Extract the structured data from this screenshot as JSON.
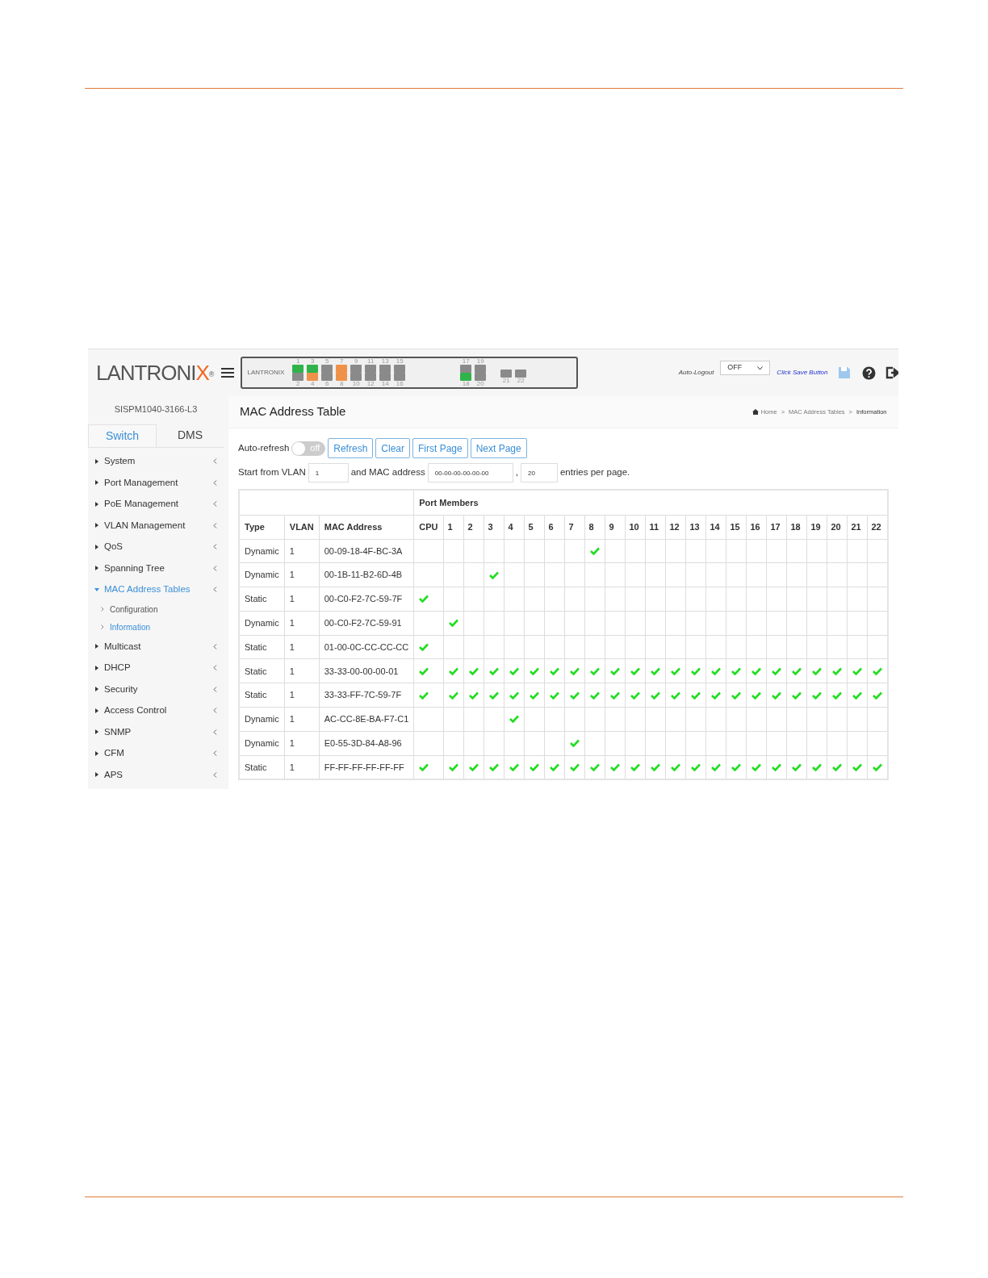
{
  "header": {
    "logo": {
      "text": "LANTRONI",
      "accent": "X",
      "mark": "®"
    },
    "device": {
      "brand": "LANTRONIX",
      "ports": [
        {
          "label": "1",
          "color": "#2fb34a"
        },
        {
          "label": "2",
          "color": "#8a8a8a"
        },
        {
          "label": "3",
          "color": "#2fb34a"
        },
        {
          "label": "4",
          "color": "#f0914a"
        },
        {
          "label": "5",
          "color": "#8a8a8a"
        },
        {
          "label": "6",
          "color": "#8a8a8a"
        },
        {
          "label": "7",
          "color": "#f0914a"
        },
        {
          "label": "8",
          "color": "#f0914a"
        },
        {
          "label": "9",
          "color": "#8a8a8a"
        },
        {
          "label": "10",
          "color": "#8a8a8a"
        },
        {
          "label": "11",
          "color": "#8a8a8a"
        },
        {
          "label": "12",
          "color": "#8a8a8a"
        },
        {
          "label": "13",
          "color": "#8a8a8a"
        },
        {
          "label": "14",
          "color": "#8a8a8a"
        },
        {
          "label": "15",
          "color": "#8a8a8a"
        },
        {
          "label": "16",
          "color": "#8a8a8a"
        }
      ],
      "sfp_ports": [
        {
          "label": "17",
          "color": "#8a8a8a"
        },
        {
          "label": "18",
          "color": "#2fb34a"
        },
        {
          "label": "19",
          "color": "#8a8a8a"
        },
        {
          "label": "20",
          "color": "#8a8a8a"
        }
      ],
      "extra_ports": [
        {
          "label": "21",
          "color": "#8a8a8a"
        },
        {
          "label": "22",
          "color": "#8a8a8a"
        }
      ]
    },
    "auto_logout": {
      "label": "Auto-Logout",
      "value": "OFF"
    },
    "save_hint": "Click Save Button"
  },
  "sidebar": {
    "model": "SISPM1040-3166-L3",
    "tabs": [
      {
        "label": "Switch",
        "selected": true
      },
      {
        "label": "DMS",
        "selected": false
      }
    ],
    "items": [
      {
        "label": "System",
        "expanded": false
      },
      {
        "label": "Port Management",
        "expanded": false
      },
      {
        "label": "PoE Management",
        "expanded": false
      },
      {
        "label": "VLAN Management",
        "expanded": false
      },
      {
        "label": "QoS",
        "expanded": false
      },
      {
        "label": "Spanning Tree",
        "expanded": false
      },
      {
        "label": "MAC Address Tables",
        "expanded": true,
        "children": [
          {
            "label": "Configuration",
            "selected": false
          },
          {
            "label": "Information",
            "selected": true
          }
        ]
      },
      {
        "label": "Multicast",
        "expanded": false
      },
      {
        "label": "DHCP",
        "expanded": false
      },
      {
        "label": "Security",
        "expanded": false
      },
      {
        "label": "Access Control",
        "expanded": false
      },
      {
        "label": "SNMP",
        "expanded": false
      },
      {
        "label": "CFM",
        "expanded": false
      },
      {
        "label": "APS",
        "expanded": false
      }
    ]
  },
  "page": {
    "title": "MAC Address Table",
    "breadcrumb": [
      {
        "label": "Home",
        "separator": ">"
      },
      {
        "label": "MAC Address Tables",
        "separator": ">"
      },
      {
        "label": "Information"
      }
    ],
    "auto_refresh": {
      "label": "Auto-refresh",
      "on": false,
      "state_text": "off"
    },
    "buttons": [
      "Refresh",
      "Clear",
      "First Page",
      "Next Page"
    ],
    "filter": {
      "vlan_label": "Start from VLAN",
      "vlan": "1",
      "mac_label": "and MAC address",
      "mac": "00-00-00-00-00-00",
      "comma": ",",
      "entries": "20",
      "entries_label": "entries per page."
    },
    "table": {
      "group_heading": "Port Members",
      "columns": [
        "Type",
        "VLAN",
        "MAC Address",
        "CPU",
        "1",
        "2",
        "3",
        "4",
        "5",
        "6",
        "7",
        "8",
        "9",
        "10",
        "11",
        "12",
        "13",
        "14",
        "15",
        "16",
        "17",
        "18",
        "19",
        "20",
        "21",
        "22"
      ],
      "rows": [
        {
          "type": "Dynamic",
          "vlan": "1",
          "mac": "00-09-18-4F-BC-3A",
          "members": [
            false,
            false,
            false,
            false,
            false,
            false,
            false,
            false,
            true,
            false,
            false,
            false,
            false,
            false,
            false,
            false,
            false,
            false,
            false,
            false,
            false,
            false,
            false
          ]
        },
        {
          "type": "Dynamic",
          "vlan": "1",
          "mac": "00-1B-11-B2-6D-4B",
          "members": [
            false,
            false,
            false,
            true,
            false,
            false,
            false,
            false,
            false,
            false,
            false,
            false,
            false,
            false,
            false,
            false,
            false,
            false,
            false,
            false,
            false,
            false,
            false
          ]
        },
        {
          "type": "Static",
          "vlan": "1",
          "mac": "00-C0-F2-7C-59-7F",
          "members": [
            true,
            false,
            false,
            false,
            false,
            false,
            false,
            false,
            false,
            false,
            false,
            false,
            false,
            false,
            false,
            false,
            false,
            false,
            false,
            false,
            false,
            false,
            false
          ]
        },
        {
          "type": "Dynamic",
          "vlan": "1",
          "mac": "00-C0-F2-7C-59-91",
          "members": [
            false,
            true,
            false,
            false,
            false,
            false,
            false,
            false,
            false,
            false,
            false,
            false,
            false,
            false,
            false,
            false,
            false,
            false,
            false,
            false,
            false,
            false,
            false
          ]
        },
        {
          "type": "Static",
          "vlan": "1",
          "mac": "01-00-0C-CC-CC-CC",
          "members": [
            true,
            false,
            false,
            false,
            false,
            false,
            false,
            false,
            false,
            false,
            false,
            false,
            false,
            false,
            false,
            false,
            false,
            false,
            false,
            false,
            false,
            false,
            false
          ]
        },
        {
          "type": "Static",
          "vlan": "1",
          "mac": "33-33-00-00-00-01",
          "members": [
            true,
            true,
            true,
            true,
            true,
            true,
            true,
            true,
            true,
            true,
            true,
            true,
            true,
            true,
            true,
            true,
            true,
            true,
            true,
            true,
            true,
            true,
            true
          ]
        },
        {
          "type": "Static",
          "vlan": "1",
          "mac": "33-33-FF-7C-59-7F",
          "members": [
            true,
            true,
            true,
            true,
            true,
            true,
            true,
            true,
            true,
            true,
            true,
            true,
            true,
            true,
            true,
            true,
            true,
            true,
            true,
            true,
            true,
            true,
            true
          ]
        },
        {
          "type": "Dynamic",
          "vlan": "1",
          "mac": "AC-CC-8E-BA-F7-C1",
          "members": [
            false,
            false,
            false,
            false,
            true,
            false,
            false,
            false,
            false,
            false,
            false,
            false,
            false,
            false,
            false,
            false,
            false,
            false,
            false,
            false,
            false,
            false,
            false
          ]
        },
        {
          "type": "Dynamic",
          "vlan": "1",
          "mac": "E0-55-3D-84-A8-96",
          "members": [
            false,
            false,
            false,
            false,
            false,
            false,
            false,
            true,
            false,
            false,
            false,
            false,
            false,
            false,
            false,
            false,
            false,
            false,
            false,
            false,
            false,
            false,
            false
          ]
        },
        {
          "type": "Static",
          "vlan": "1",
          "mac": "FF-FF-FF-FF-FF-FF",
          "members": [
            true,
            true,
            true,
            true,
            true,
            true,
            true,
            true,
            true,
            true,
            true,
            true,
            true,
            true,
            true,
            true,
            true,
            true,
            true,
            true,
            true,
            true,
            true
          ]
        }
      ]
    }
  }
}
